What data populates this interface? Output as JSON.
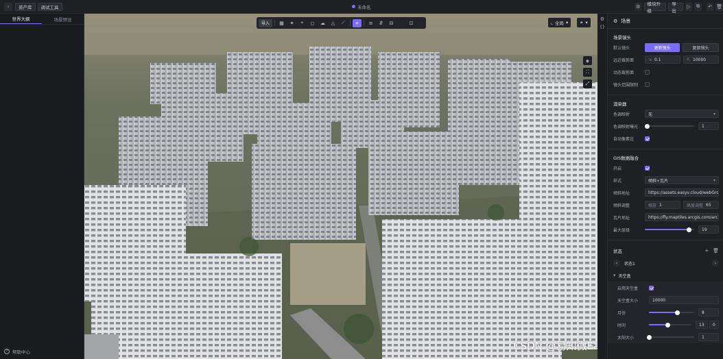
{
  "topbar": {
    "back_label": "‹",
    "resource_library": "资产库",
    "debug_tools": "调试工具",
    "doc_title": "未命名",
    "upgrade": "模块升级",
    "export": "导出"
  },
  "left": {
    "tabs": [
      "世界大纲",
      "场景预设"
    ],
    "help": "帮助中心"
  },
  "viewport": {
    "toolbar_first": "导入",
    "view_mode": "全局",
    "watermark": "CSDN @易知微EasyV数据可视化"
  },
  "panel": {
    "title": "场景",
    "camera_section": "场景镜头",
    "default_camera_label": "默认镜头",
    "update_camera": "更新镜头",
    "reset_camera": "复原镜头",
    "clip_label": "远近裁剪面",
    "clip_near": "0.1",
    "clip_far": "10000",
    "dynamic_clip_label": "动态裁剪面",
    "camera_limit_label": "镜头范围限制",
    "render_section": "渲染器",
    "tonemap_label": "色调映射",
    "tonemap_value": "无",
    "exposure_label": "色调映射曝光",
    "exposure_value": "1",
    "auto_pixel_label": "自动像素比",
    "gis_section": "GIS数据融合",
    "enable_label": "开启",
    "style_label": "样式",
    "style_value": "倾斜+瓦片",
    "tilt_url_label": "倾斜地址",
    "tilt_url": "https://assets.easyv.cloud/webGroup",
    "tilt_adjust_label": "倾斜调整",
    "scale_label": "缩放",
    "scale_value": "1",
    "height_label": "高度调整",
    "height_value": "65",
    "tile_url_label": "瓦片地址",
    "tile_url": "https://fly.maptiles.arcgis.com/arcgis",
    "max_level_label": "最大层级",
    "max_level_value": "19",
    "max_level_fraction": 0.9,
    "state_section": "状态",
    "state_name": "状态1",
    "skybox_section": "天空盒",
    "enable_skybox_label": "启用天空盒",
    "skybox_size_label": "天空盒大小",
    "skybox_size": "10000",
    "month_label": "月份",
    "month_value": "8",
    "month_fraction": 0.63,
    "time_label": "时间",
    "time_hour": "13",
    "time_min": "0",
    "time_fraction": 0.45,
    "sun_size_label": "太阳大小",
    "sun_size_value": "1"
  },
  "colors": {
    "accent": "#7b6cff",
    "panel_bg": "#1f2024"
  }
}
